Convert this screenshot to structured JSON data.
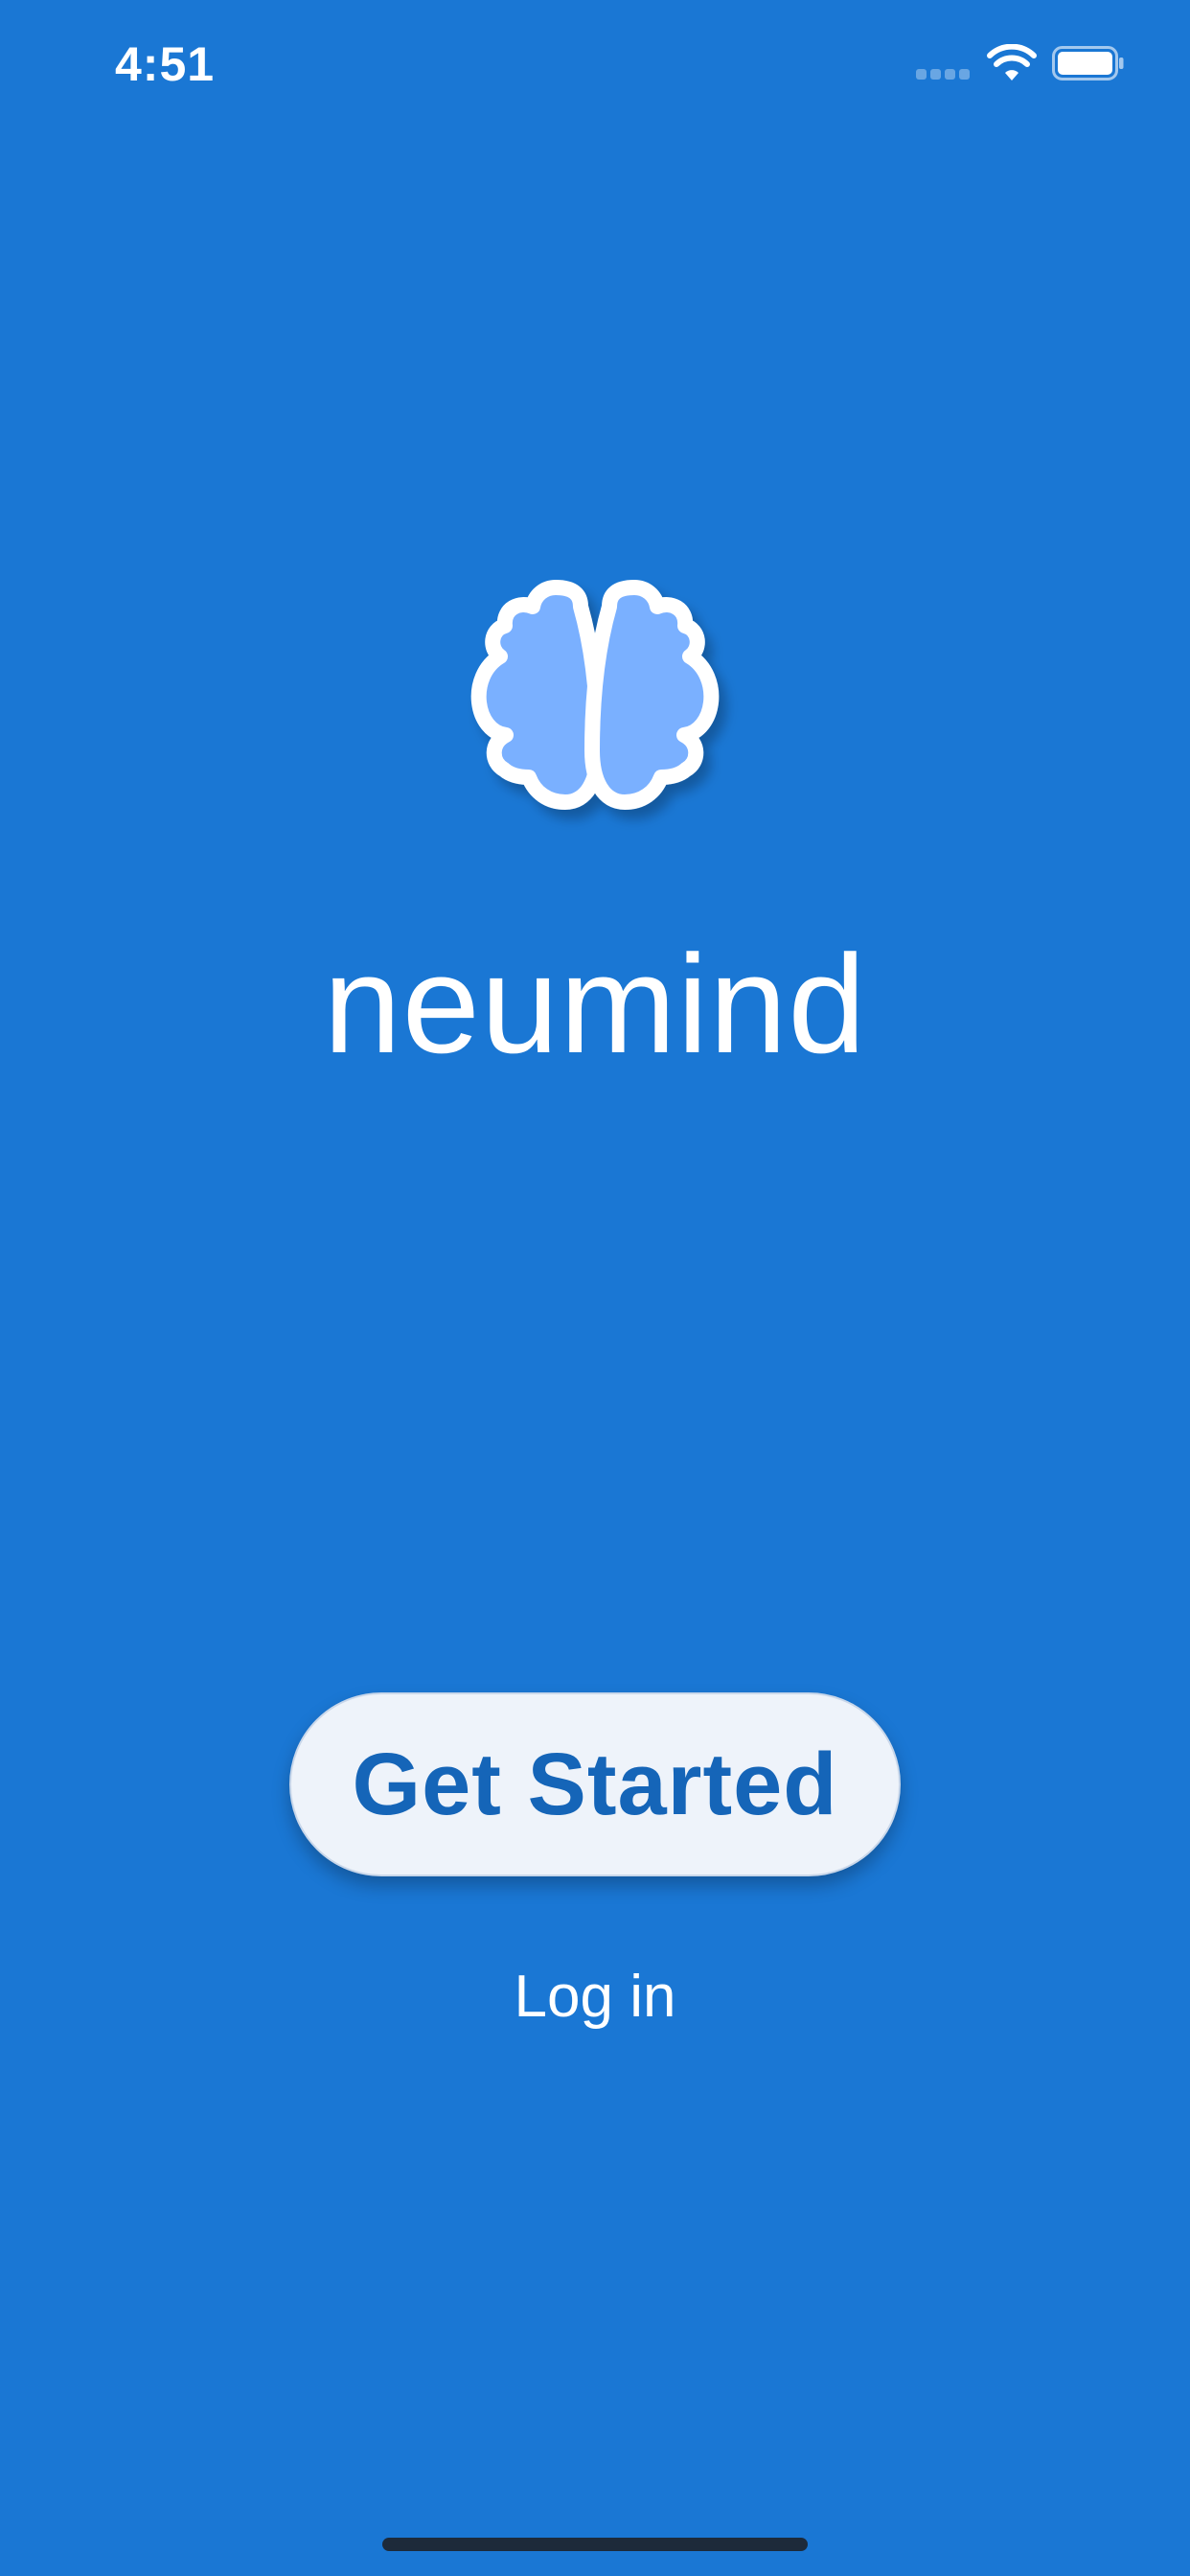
{
  "status_bar": {
    "time": "4:51",
    "icons": [
      "cellular-signal-icon",
      "wifi-icon",
      "battery-icon"
    ]
  },
  "brand": {
    "name": "neumind",
    "logo_icon": "brain-icon",
    "logo_colors": {
      "fill": "#7ab0ff",
      "outline": "#ffffff"
    }
  },
  "actions": {
    "get_started_label": "Get Started",
    "login_label": "Log in"
  },
  "colors": {
    "background": "#1a77d4",
    "button_bg": "#eef3fa",
    "button_text": "#1565b8",
    "text": "#ffffff"
  }
}
